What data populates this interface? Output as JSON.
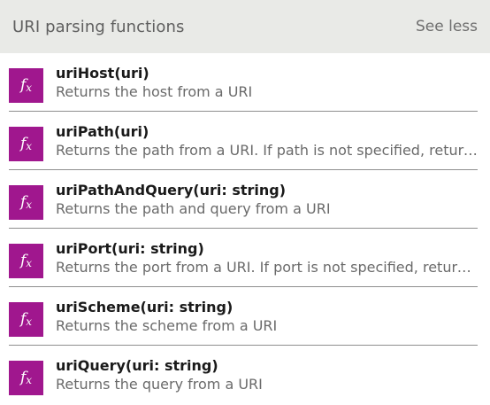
{
  "header": {
    "title": "URI parsing functions",
    "toggle_label": "See less"
  },
  "icon": {
    "name": "fx-function-icon",
    "glyph_main": "f",
    "glyph_sub": "x",
    "color": "#a0178e"
  },
  "functions": [
    {
      "name": "uriHost(uri)",
      "description": "Returns the host from a URI"
    },
    {
      "name": "uriPath(uri)",
      "description": "Returns the path from a URI. If path is not specified, return..."
    },
    {
      "name": "uriPathAndQuery(uri: string)",
      "description": "Returns the path and query from a URI"
    },
    {
      "name": "uriPort(uri: string)",
      "description": "Returns the port from a URI. If port is not specified, return..."
    },
    {
      "name": "uriScheme(uri: string)",
      "description": "Returns the scheme from a URI"
    },
    {
      "name": "uriQuery(uri: string)",
      "description": "Returns the query from a URI"
    }
  ]
}
